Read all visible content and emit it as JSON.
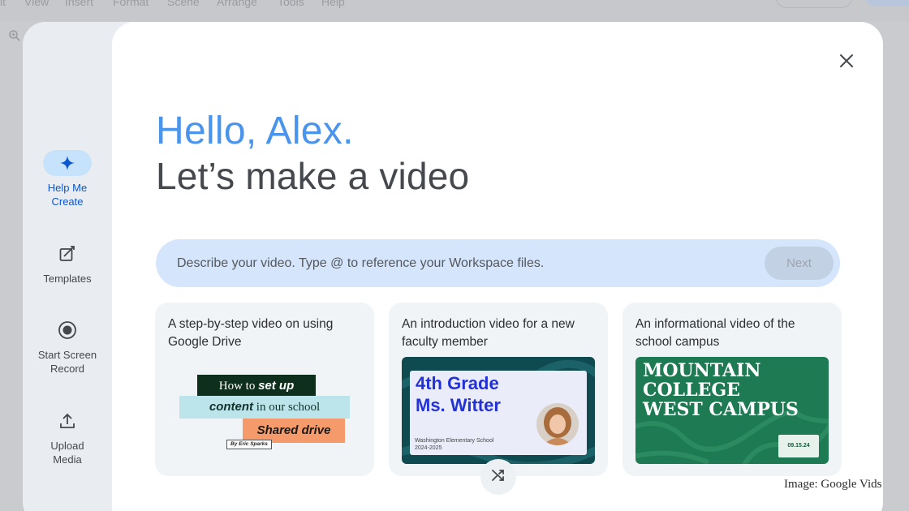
{
  "background_app": {
    "menu": [
      "it",
      "View",
      "Insert",
      "Format",
      "Scene",
      "Arrange",
      "Tools",
      "Help"
    ]
  },
  "rail": {
    "items": [
      {
        "label": "Help Me\nCreate",
        "icon": "sparkle-icon",
        "active": true
      },
      {
        "label": "Templates",
        "icon": "template-icon",
        "active": false
      },
      {
        "label": "Start Screen\nRecord",
        "icon": "record-icon",
        "active": false
      },
      {
        "label": "Upload\nMedia",
        "icon": "upload-icon",
        "active": false
      }
    ]
  },
  "greeting": "Hello, Alex.",
  "headline": "Let’s make a video",
  "prompt": {
    "placeholder": "Describe your video. Type @ to reference your Workspace files.",
    "next_label": "Next"
  },
  "cards": [
    {
      "title": "A step-by-step video on using Google Drive",
      "thumb": {
        "line1_a": "How to ",
        "line1_b": "set up",
        "line2_a": "content",
        "line2_b": " in our school",
        "line3": "Shared drive",
        "byline": "By Eric Sparks"
      }
    },
    {
      "title": "An introduction video for a new faculty member",
      "thumb": {
        "line1": "4th Grade",
        "line2": "Ms. Witter",
        "school": "Washington Elementary School",
        "year": "2024-2025"
      }
    },
    {
      "title": "An informational video of the school campus",
      "thumb": {
        "line1": "MOUNTAIN",
        "line2": "COLLEGE",
        "line3": "WEST CAMPUS",
        "date": "09.15.24"
      }
    }
  ],
  "credit": "Image: Google Vids",
  "colors": {
    "greeting": "#4a94ec",
    "headline": "#45484c",
    "prompt_bg": "#d5e5fc",
    "rail_active": "#c7e3fb",
    "card_bg": "#f1f4f7"
  }
}
